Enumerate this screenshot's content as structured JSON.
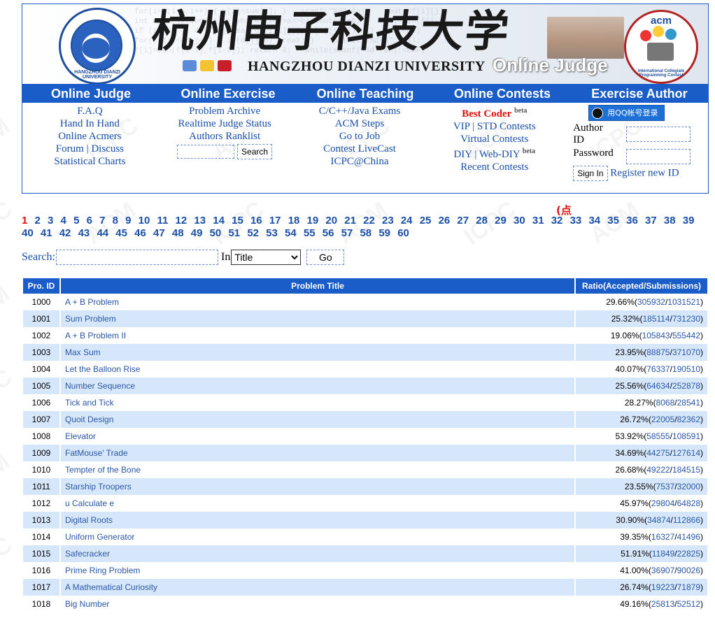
{
  "header": {
    "cn_title": "杭州电子科技大学",
    "en_title": "HANGZHOU DIANZI UNIVERSITY",
    "oj_title": "Online Judge",
    "seal_text": "HANGZHOU DIANZI UNIVERSITY",
    "acm_badge_title": "acm",
    "acm_badge_text": "International Collegiate Programming Contest"
  },
  "nav": {
    "headers": [
      "Online Judge",
      "Online Exercise",
      "Online Teaching",
      "Online Contests",
      "Exercise Author"
    ],
    "judge": [
      "F.A.Q",
      "Hand In Hand",
      "Online Acmers",
      "Forum",
      "Discuss",
      "Statistical Charts"
    ],
    "exercise": [
      "Problem Archive",
      "Realtime Judge Status",
      "Authors Ranklist"
    ],
    "exercise_search_button": "Search",
    "teaching": [
      "C/C++/Java Exams",
      "ACM Steps",
      "Go to Job",
      "Contest LiveCast",
      "ICPC@China"
    ],
    "contests": {
      "best_coder": "Best Coder",
      "beta": "beta",
      "vip": "VIP",
      "std": "STD Contests",
      "virtual": "Virtual Contests",
      "diy": "DIY",
      "webdiy": "Web-DIY",
      "recent": "Recent Contests"
    },
    "author": {
      "qq_login": "用QQ帐号登录",
      "author_id_label_1": "Author",
      "author_id_label_2": "ID",
      "password_label": "Password",
      "sign_in": "Sign In",
      "register": "Register new ID"
    }
  },
  "pager": {
    "current": "1",
    "click_tip": "(点",
    "pages": [
      "1",
      "2",
      "3",
      "4",
      "5",
      "6",
      "7",
      "8",
      "9",
      "10",
      "11",
      "12",
      "13",
      "14",
      "15",
      "16",
      "17",
      "18",
      "19",
      "20",
      "21",
      "22",
      "23",
      "24",
      "25",
      "26",
      "27",
      "28",
      "29",
      "30",
      "31",
      "32",
      "33",
      "34",
      "35",
      "36",
      "37",
      "38",
      "39",
      "40",
      "41",
      "42",
      "43",
      "44",
      "45",
      "46",
      "47",
      "48",
      "49",
      "50",
      "51",
      "52",
      "53",
      "54",
      "55",
      "56",
      "57",
      "58",
      "59",
      "60"
    ]
  },
  "search": {
    "label": "Search:",
    "in_label": "In",
    "field_selected": "Title",
    "go": "Go"
  },
  "table": {
    "headers": [
      "Pro. ID",
      "Problem Title",
      "Ratio(Accepted/Submissions)"
    ],
    "rows": [
      {
        "id": "1000",
        "title": "A + B Problem",
        "pct": "29.66%",
        "acc": "305932",
        "sub": "1031521"
      },
      {
        "id": "1001",
        "title": "Sum Problem",
        "pct": "25.32%",
        "acc": "185114",
        "sub": "731230"
      },
      {
        "id": "1002",
        "title": "A + B Problem II",
        "pct": "19.06%",
        "acc": "105843",
        "sub": "555442"
      },
      {
        "id": "1003",
        "title": "Max Sum",
        "pct": "23.95%",
        "acc": "88875",
        "sub": "371070"
      },
      {
        "id": "1004",
        "title": "Let the Balloon Rise",
        "pct": "40.07%",
        "acc": "76337",
        "sub": "190510"
      },
      {
        "id": "1005",
        "title": "Number Sequence",
        "pct": "25.56%",
        "acc": "64634",
        "sub": "252878"
      },
      {
        "id": "1006",
        "title": "Tick and Tick",
        "pct": "28.27%",
        "acc": "8068",
        "sub": "28541"
      },
      {
        "id": "1007",
        "title": "Quoit Design",
        "pct": "26.72%",
        "acc": "22005",
        "sub": "82362"
      },
      {
        "id": "1008",
        "title": "Elevator",
        "pct": "53.92%",
        "acc": "58555",
        "sub": "108591"
      },
      {
        "id": "1009",
        "title": "FatMouse' Trade",
        "pct": "34.69%",
        "acc": "44275",
        "sub": "127614"
      },
      {
        "id": "1010",
        "title": "Tempter of the Bone",
        "pct": "26.68%",
        "acc": "49222",
        "sub": "184515"
      },
      {
        "id": "1011",
        "title": "Starship Troopers",
        "pct": "23.55%",
        "acc": "7537",
        "sub": "32000"
      },
      {
        "id": "1012",
        "title": "u Calculate e",
        "pct": "45.97%",
        "acc": "29804",
        "sub": "64828"
      },
      {
        "id": "1013",
        "title": "Digital Roots",
        "pct": "30.90%",
        "acc": "34874",
        "sub": "112866"
      },
      {
        "id": "1014",
        "title": "Uniform Generator",
        "pct": "39.35%",
        "acc": "16327",
        "sub": "41496"
      },
      {
        "id": "1015",
        "title": "Safecracker",
        "pct": "51.91%",
        "acc": "11849",
        "sub": "22825"
      },
      {
        "id": "1016",
        "title": "Prime Ring Problem",
        "pct": "41.00%",
        "acc": "36907",
        "sub": "90026"
      },
      {
        "id": "1017",
        "title": "A Mathematical Curiosity",
        "pct": "26.74%",
        "acc": "19223",
        "sub": "71879"
      },
      {
        "id": "1018",
        "title": "Big Number",
        "pct": "49.16%",
        "acc": "25813",
        "sub": "52512"
      }
    ]
  }
}
